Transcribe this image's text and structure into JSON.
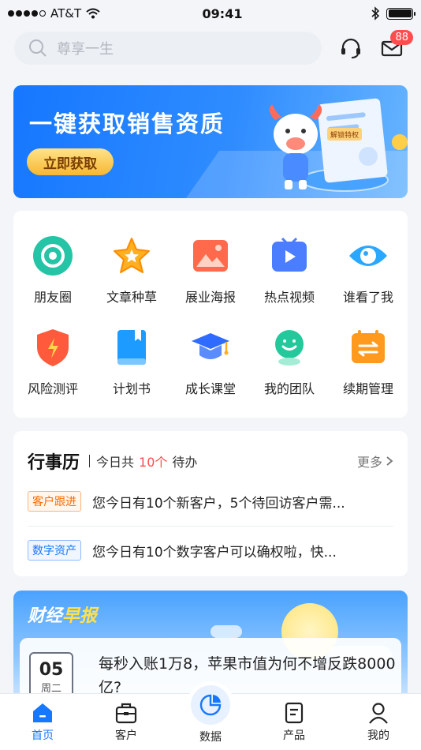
{
  "status_bar": {
    "carrier": "AT&T",
    "time": "09:41"
  },
  "search": {
    "placeholder": "尊享一生"
  },
  "header": {
    "message_badge": "88"
  },
  "banner": {
    "title": "一键获取销售资质",
    "cta_label": "立即获取",
    "ribbon_text": "解锁特权"
  },
  "grid": {
    "items": [
      {
        "label": "朋友圈",
        "icon": "aperture-icon"
      },
      {
        "label": "文章种草",
        "icon": "star-icon"
      },
      {
        "label": "展业海报",
        "icon": "image-icon"
      },
      {
        "label": "热点视频",
        "icon": "video-icon"
      },
      {
        "label": "谁看了我",
        "icon": "eye-icon"
      },
      {
        "label": "风险测评",
        "icon": "shield-icon"
      },
      {
        "label": "计划书",
        "icon": "book-icon"
      },
      {
        "label": "成长课堂",
        "icon": "graduation-cap-icon"
      },
      {
        "label": "我的团队",
        "icon": "team-icon"
      },
      {
        "label": "续期管理",
        "icon": "calendar-renew-icon"
      }
    ]
  },
  "calendar": {
    "title": "行事历",
    "subtitle_prefix": "今日共",
    "count": "10个",
    "subtitle_suffix": "待办",
    "more_label": "更多",
    "rows": [
      {
        "tag": "客户跟进",
        "text": "您今日有10个新客户，5个待回访客户需..."
      },
      {
        "tag": "数字资产",
        "text": "您今日有10个数字客户可以确权啦，快..."
      }
    ]
  },
  "news": {
    "title_a": "财经",
    "title_b": "早报",
    "day": "05",
    "weekday": "周二",
    "headline": "每秒入账1万8，苹果市值为何不增反跌8000亿?"
  },
  "tabbar": {
    "tabs": [
      {
        "label": "首页",
        "icon": "home-icon"
      },
      {
        "label": "客户",
        "icon": "briefcase-icon"
      },
      {
        "label": "数据",
        "icon": "pie-chart-icon"
      },
      {
        "label": "产品",
        "icon": "document-icon"
      },
      {
        "label": "我的",
        "icon": "user-icon"
      }
    ]
  },
  "colors": {
    "primary": "#1677ff",
    "accent_red": "#ff4d4f",
    "cta_gold": "#f7b733",
    "tag_orange": "#ff6a00"
  }
}
